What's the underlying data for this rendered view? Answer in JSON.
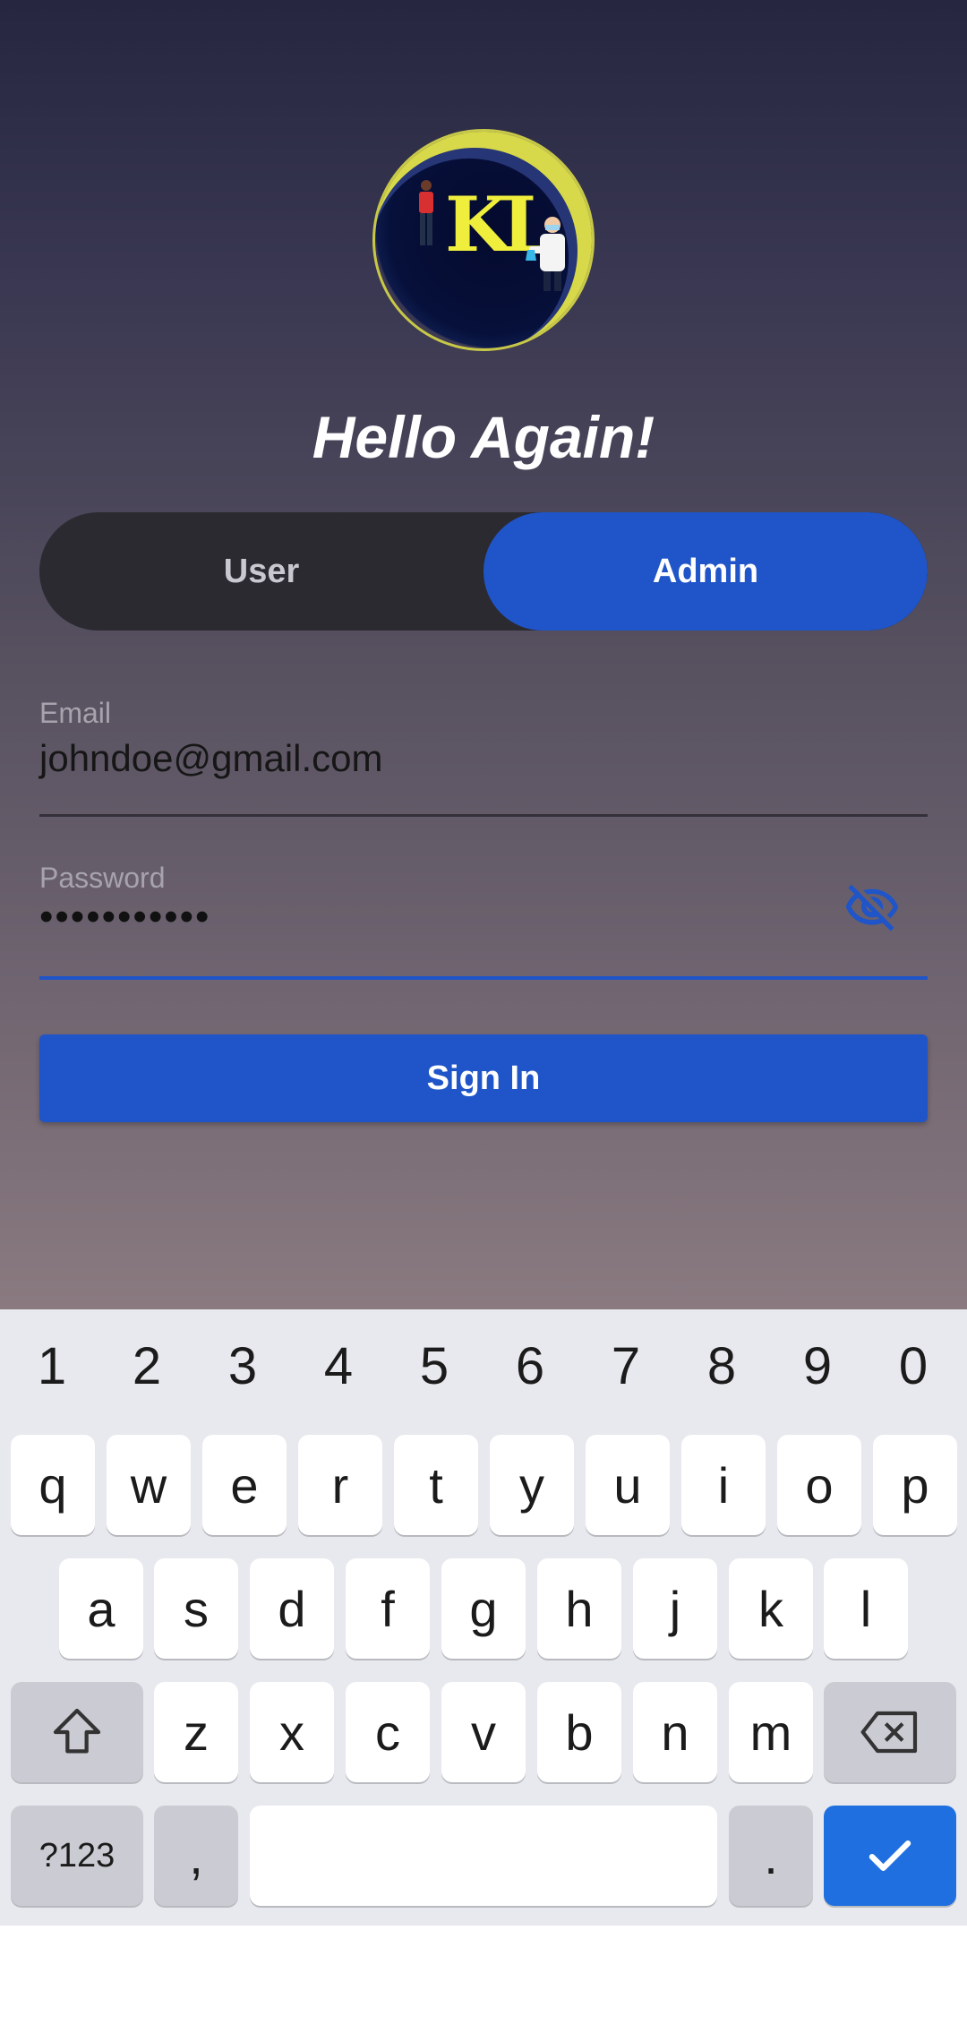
{
  "login": {
    "title": "Hello Again!",
    "toggle": {
      "user": "User",
      "admin": "Admin",
      "selected": "Admin"
    },
    "email": {
      "label": "Email",
      "value": "johndoe@gmail.com"
    },
    "password": {
      "label": "Password",
      "value": "•••••••••••"
    },
    "sign_in": "Sign In",
    "logo_text": "KL"
  },
  "keyboard": {
    "numbers": [
      "1",
      "2",
      "3",
      "4",
      "5",
      "6",
      "7",
      "8",
      "9",
      "0"
    ],
    "row1": [
      "q",
      "w",
      "e",
      "r",
      "t",
      "y",
      "u",
      "i",
      "o",
      "p"
    ],
    "row2": [
      "a",
      "s",
      "d",
      "f",
      "g",
      "h",
      "j",
      "k",
      "l"
    ],
    "row3": [
      "z",
      "x",
      "c",
      "v",
      "b",
      "n",
      "m"
    ],
    "symbols": "?123",
    "comma": ",",
    "period": "."
  },
  "colors": {
    "accent": "#1f55c8",
    "toggle_bg": "#2b2a30",
    "keyboard_bg": "#e8e9ee",
    "enter_key": "#1f6fe0"
  }
}
